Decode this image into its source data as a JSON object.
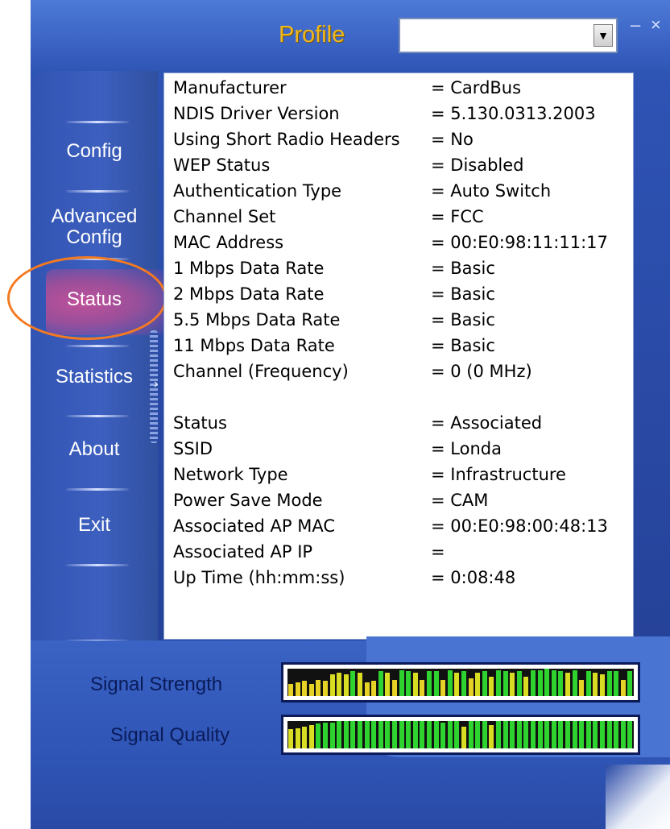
{
  "header": {
    "profile_label": "Profile",
    "profile_value": "",
    "minimize_label": "–",
    "close_label": "×"
  },
  "sidebar": {
    "items": [
      {
        "label": "Config"
      },
      {
        "label": "Advanced\nConfig"
      },
      {
        "label": "Status"
      },
      {
        "label": "Statistics"
      },
      {
        "label": "About"
      },
      {
        "label": "Exit"
      }
    ]
  },
  "status_rows": [
    {
      "label": "Manufacturer",
      "value": "= CardBus"
    },
    {
      "label": "NDIS Driver Version",
      "value": "= 5.130.0313.2003"
    },
    {
      "label": "Using Short Radio Headers",
      "value": "= No"
    },
    {
      "label": "WEP Status",
      "value": "= Disabled"
    },
    {
      "label": "Authentication Type",
      "value": "= Auto Switch"
    },
    {
      "label": "Channel Set",
      "value": "= FCC"
    },
    {
      "label": "MAC Address",
      "value": "= 00:E0:98:11:11:17"
    },
    {
      "label": "1 Mbps Data Rate",
      "value": "= Basic"
    },
    {
      "label": "2 Mbps Data Rate",
      "value": "= Basic"
    },
    {
      "label": "5.5 Mbps Data Rate",
      "value": "= Basic"
    },
    {
      "label": "11 Mbps Data Rate",
      "value": "= Basic"
    },
    {
      "label": "Channel (Frequency)",
      "value": "= 0 (0 MHz)"
    },
    {
      "label": "Status",
      "value": "= Associated"
    },
    {
      "label": "SSID",
      "value": "= Londa"
    },
    {
      "label": "Network Type",
      "value": "= Infrastructure"
    },
    {
      "label": "Power Save Mode",
      "value": "= CAM"
    },
    {
      "label": "Associated AP MAC",
      "value": "= 00:E0:98:00:48:13"
    },
    {
      "label": "Associated AP IP",
      "value": "="
    },
    {
      "label": "Up Time (hh:mm:ss)",
      "value": "= 0:08:48"
    }
  ],
  "signals": {
    "strength_label": "Signal Strength",
    "quality_label": "Signal Quality",
    "strength_levels": [
      0.45,
      0.5,
      0.55,
      0.45,
      0.6,
      0.55,
      0.8,
      0.85,
      0.8,
      0.9,
      0.85,
      0.5,
      0.55,
      0.9,
      0.85,
      0.6,
      0.95,
      0.9,
      0.85,
      0.6,
      0.9,
      0.9,
      0.6,
      0.95,
      0.85,
      0.9,
      0.65,
      0.85,
      0.9,
      0.7,
      0.95,
      0.9,
      0.85,
      0.9,
      0.7,
      0.95,
      0.95,
      1.0,
      0.95,
      0.9,
      0.85,
      0.95,
      0.6,
      0.9,
      0.85,
      0.8,
      0.9,
      0.9,
      0.6,
      0.9
    ],
    "quality_levels": [
      0.7,
      0.75,
      0.8,
      0.85,
      0.9,
      0.95,
      0.95,
      1.0,
      1.0,
      1.0,
      1.0,
      1.0,
      1.0,
      1.0,
      1.0,
      1.0,
      1.0,
      1.0,
      1.0,
      1.0,
      1.0,
      1.0,
      0.95,
      1.0,
      1.0,
      0.8,
      1.0,
      1.0,
      1.0,
      0.85,
      1.0,
      1.0,
      1.0,
      1.0,
      1.0,
      1.0,
      1.0,
      1.0,
      1.0,
      1.0,
      1.0,
      1.0,
      1.0,
      1.0,
      1.0,
      1.0,
      1.0,
      1.0,
      1.0,
      1.0
    ],
    "colors": {
      "high": "#2fd32f",
      "mid": "#d8dc22",
      "low": "#e6d126"
    }
  },
  "accent_colors": {
    "profile_text": "#f0b81e",
    "highlight_ring": "#f47a22",
    "frame_blue": "#2f56b8"
  }
}
